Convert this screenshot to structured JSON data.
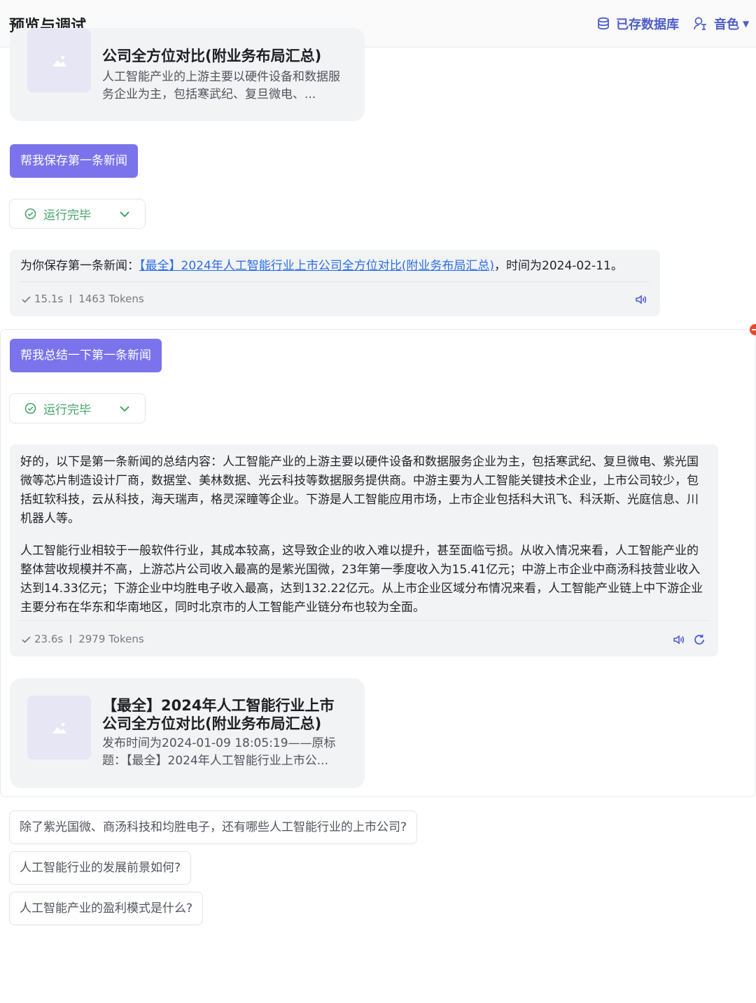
{
  "header": {
    "title": "预览与调试",
    "db_label": "已存数据库",
    "voice_label": "音色"
  },
  "top_card": {
    "title": "公司全方位对比(附业务布局汇总)",
    "desc": "人工智能产业的上游主要以硬件设备和数据服务企业为主，包括寒武纪、复旦微电、..."
  },
  "msg1": {
    "user": "帮我保存第一条新闻",
    "status": "运行完毕",
    "reply_prefix": "为你保存第一条新闻：",
    "reply_link": "【最全】2024年人工智能行业上市公司全方位对比(附业务布局汇总)",
    "reply_suffix": "，时间为2024-02-11。",
    "time": "15.1s",
    "tokens": "1463 Tokens"
  },
  "msg2": {
    "user": "帮我总结一下第一条新闻",
    "status": "运行完毕",
    "para1": "好的，以下是第一条新闻的总结内容：人工智能产业的上游主要以硬件设备和数据服务企业为主，包括寒武纪、复旦微电、紫光国微等芯片制造设计厂商，数据堂、美林数据、光云科技等数据服务提供商。中游主要为人工智能关键技术企业，上市公司较少，包括虹软科技，云从科技，海天瑞声，格灵深瞳等企业。下游是人工智能应用市场，上市企业包括科大讯飞、科沃斯、光庭信息、川机器人等。",
    "para2": "人工智能行业相较于一般软件行业，其成本较高，这导致企业的收入难以提升，甚至面临亏损。从收入情况来看，人工智能产业的整体营收规模并不高，上游芯片公司收入最高的是紫光国微，23年第一季度收入为15.41亿元；中游上市企业中商汤科技营业收入达到14.33亿元；下游企业中均胜电子收入最高，达到132.22亿元。从上市企业区域分布情况来看，人工智能产业链上中下游企业主要分布在华东和华南地区，同时北京市的人工智能产业链分布也较为全面。",
    "time": "23.6s",
    "tokens": "2979 Tokens"
  },
  "bottom_card": {
    "title": "【最全】2024年人工智能行业上市公司全方位对比(附业务布局汇总)",
    "desc": "发布时间为2024-01-09 18:05:19——原标题：【最全】2024年人工智能行业上市公..."
  },
  "suggestions": [
    "除了紫光国微、商汤科技和均胜电子，还有哪些人工智能行业的上市公司?",
    "人工智能行业的发展前景如何?",
    "人工智能产业的盈利模式是什么?"
  ],
  "colors": {
    "accent": "#7b73ec",
    "header_action": "#4e5ec8",
    "success": "#47a36a",
    "link": "#2b6ee6",
    "badge": "#e8492c"
  }
}
